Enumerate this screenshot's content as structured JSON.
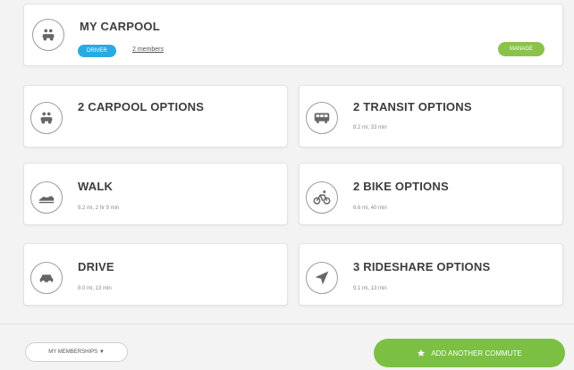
{
  "my_carpool": {
    "title": "MY CARPOOL",
    "role_badge": "DRIVER",
    "members_link": "2 members",
    "manage_label": "MANAGE",
    "icon": "carpool-icon"
  },
  "options": [
    {
      "title": "2 CARPOOL OPTIONS",
      "detail": "",
      "icon": "carpool-icon"
    },
    {
      "title": "2 TRANSIT OPTIONS",
      "detail": "8.2 mi, 33 min",
      "icon": "bus-icon"
    },
    {
      "title": "WALK",
      "detail": "8.2 mi, 2 hr 9 min",
      "icon": "walk-icon"
    },
    {
      "title": "2 BIKE OPTIONS",
      "detail": "6.6 mi, 40 min",
      "icon": "bike-icon"
    },
    {
      "title": "DRIVE",
      "detail": "8.0 mi, 13 min",
      "icon": "car-icon"
    },
    {
      "title": "3 RIDESHARE OPTIONS",
      "detail": "9.1 mi, 13 min",
      "icon": "navigation-arrow-icon"
    }
  ],
  "footer": {
    "memberships_label": "MY MEMBERSHIPS",
    "add_commute_label": "ADD ANOTHER COMMUTE",
    "add_commute_icon": "star-icon"
  },
  "colors": {
    "blue_badge": "#29abe2",
    "green_button": "#7bc043",
    "manage_green": "#8bc34a"
  }
}
